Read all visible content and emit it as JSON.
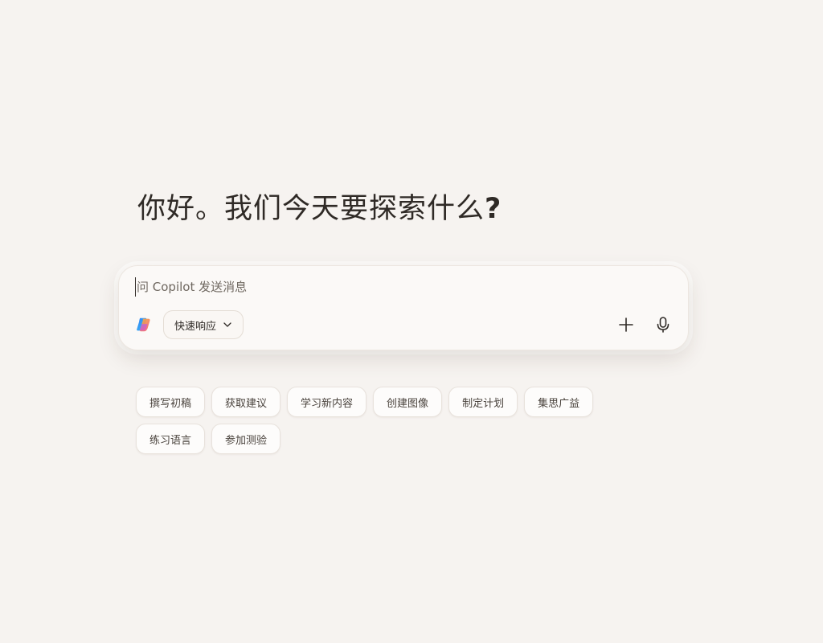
{
  "greeting": {
    "text": "你好。我们今天要探索什么",
    "punctuation": "?"
  },
  "composer": {
    "placeholder": "问 Copilot 发送消息",
    "value": "",
    "mode_label": "快速响应",
    "icons": {
      "logo": "copilot-logo-icon",
      "mode_dropdown": "chevron-down-icon",
      "add": "plus-icon",
      "voice": "microphone-icon"
    }
  },
  "suggestions": {
    "row1": [
      "撰写初稿",
      "获取建议",
      "学习新内容",
      "创建图像",
      "制定计划",
      "集思广益"
    ],
    "row2": [
      "练习语言",
      "参加测验"
    ]
  },
  "colors": {
    "background": "#f6f3f0",
    "text": "#2f2a26",
    "composer_bg": "#fbf9f7",
    "chip_bg": "#fdfcfb"
  }
}
